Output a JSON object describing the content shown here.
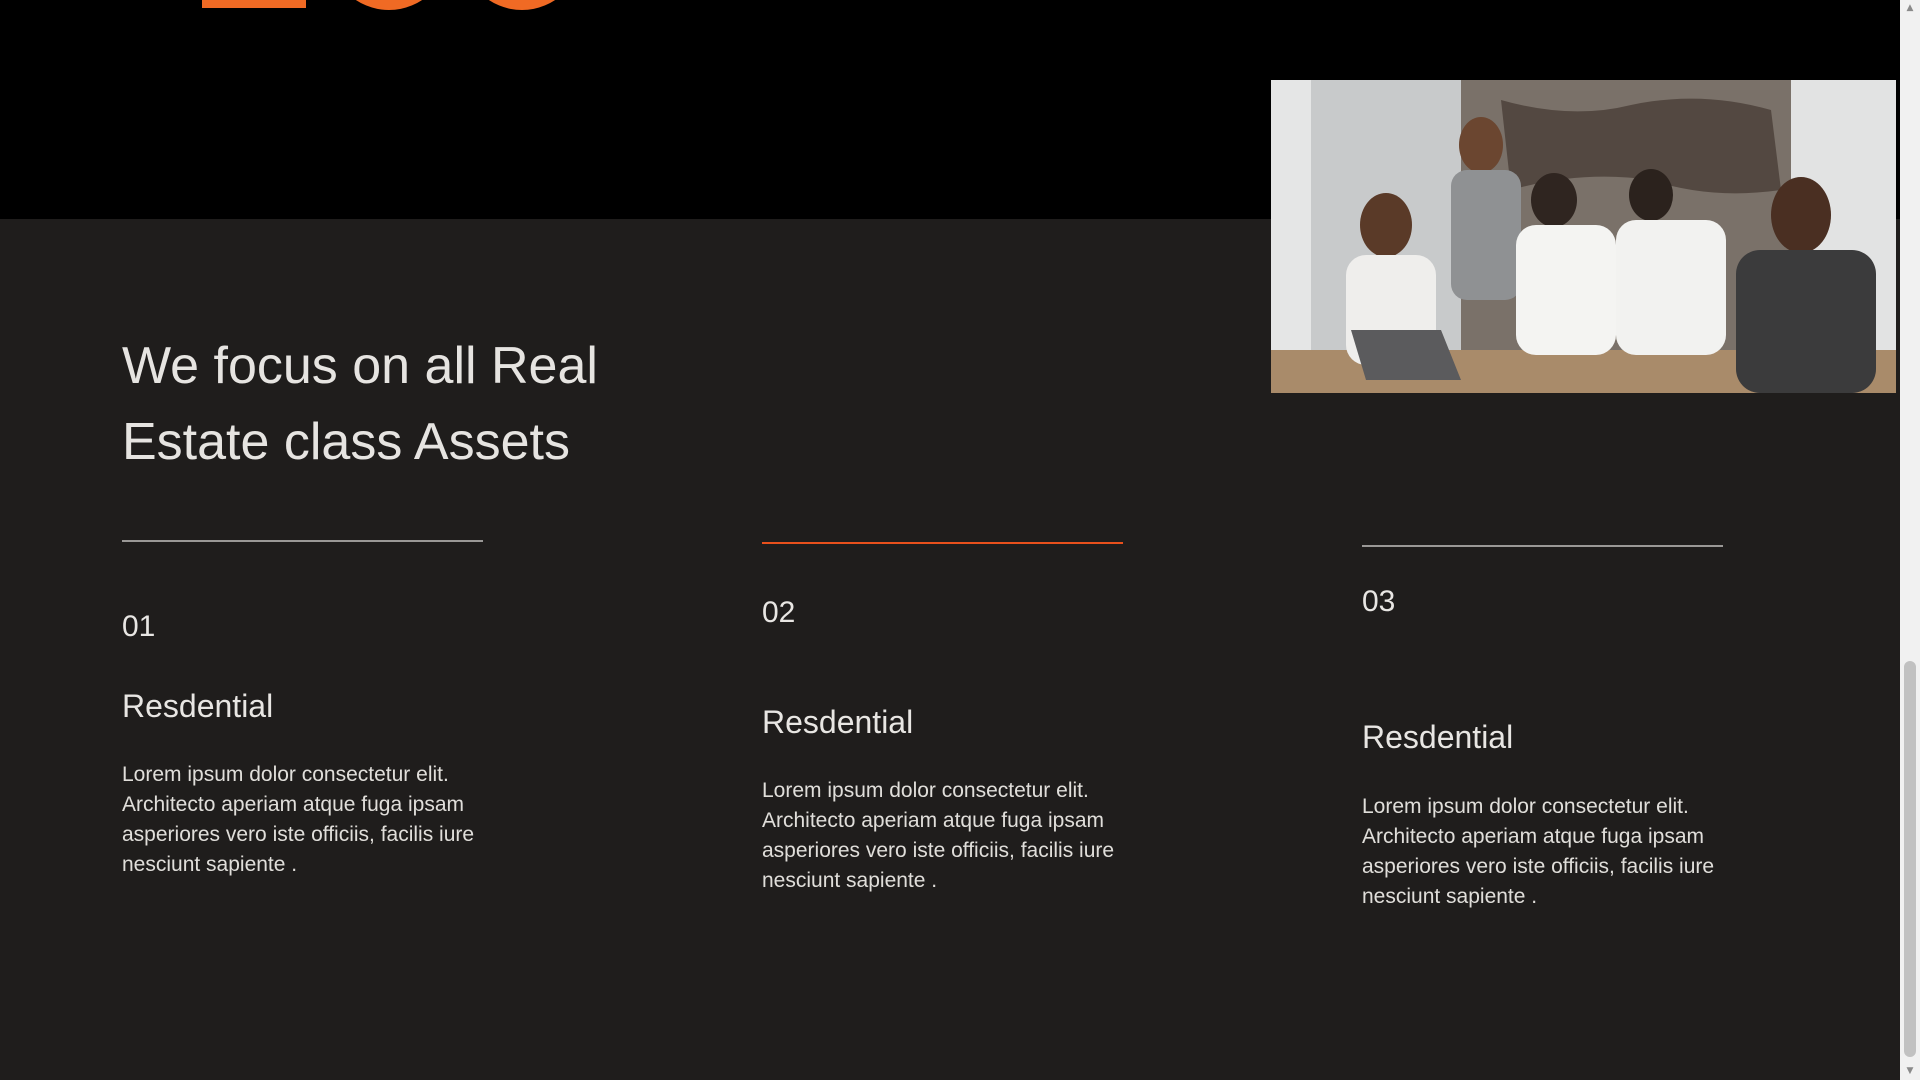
{
  "heading": {
    "line1": "We focus on all Real",
    "line2": "Estate class Assets"
  },
  "colors": {
    "accent": "#e8501c",
    "background": "#1f1d1c",
    "top_band": "#000000"
  },
  "photo": {
    "alt": "team meeting photo"
  },
  "features": [
    {
      "number": "01",
      "title": "Resdential",
      "body": "Lorem ipsum dolor consectetur elit. Architecto aperiam atque fuga ipsam asperiores vero iste officiis, facilis iure nesciunt sapiente .",
      "active": false
    },
    {
      "number": "02",
      "title": "Resdential",
      "body": "Lorem ipsum dolor consectetur elit. Architecto aperiam atque fuga ipsam asperiores vero iste officiis, facilis iure nesciunt sapiente .",
      "active": true
    },
    {
      "number": "03",
      "title": "Resdential",
      "body": "Lorem ipsum dolor consectetur elit. Architecto aperiam atque fuga ipsam asperiores vero iste officiis, facilis iure nesciunt sapiente .",
      "active": false
    }
  ],
  "scrollbar": {
    "up_icon": "chevron-up-icon",
    "down_icon": "chevron-down-icon"
  }
}
